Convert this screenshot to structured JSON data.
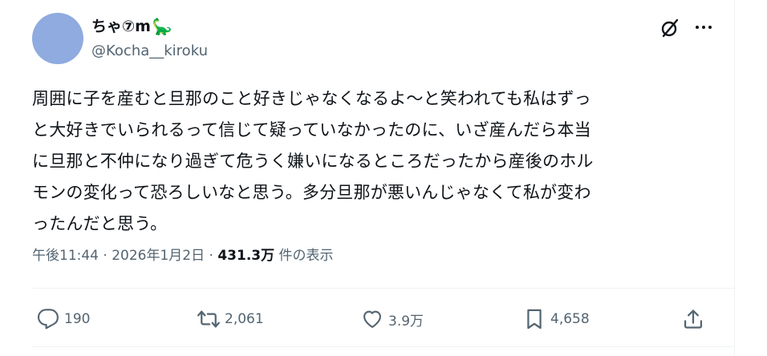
{
  "author": {
    "display_name": "ちゃ⑦m",
    "emoji": "🦕",
    "handle": "@Kocha__kiroku"
  },
  "tweet": {
    "text": "周囲に子を産むと旦那のこと好きじゃなくなるよ〜と笑われても私はずっ\nと大好きでいられるって信じて疑っていなかったのに、いざ産んだら本当\nに旦那と不仲になり過ぎて危うく嫌いになるところだったから産後のホル\nモンの変化って恐ろしいなと思う。多分旦那が悪いんじゃなくて私が変わ\nったんだと思う。",
    "time": "午後11:44",
    "separator": "·",
    "date": "2026年1月2日",
    "views_count": "431.3万",
    "views_label": "件の表示"
  },
  "actions": {
    "replies": "190",
    "reposts": "2,061",
    "likes": "3.9万",
    "bookmarks": "4,658"
  },
  "icons": {
    "grok": "grok-icon",
    "more": "more-icon",
    "reply": "reply-icon",
    "repost": "repost-icon",
    "like": "heart-icon",
    "bookmark": "bookmark-icon",
    "share": "share-icon"
  },
  "colors": {
    "avatar": "#8fabdf",
    "text": "#0f1419",
    "secondary": "#536471",
    "divider": "#eff3f4"
  }
}
